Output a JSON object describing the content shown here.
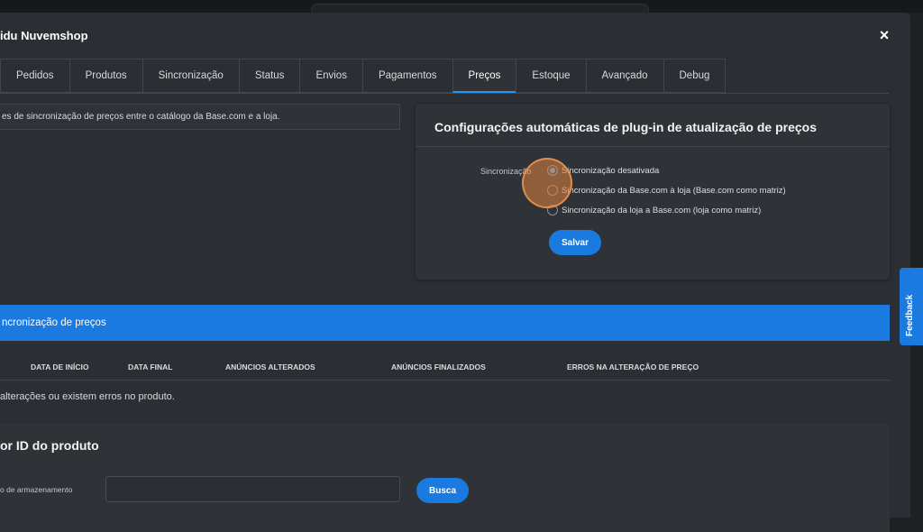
{
  "modal": {
    "title": "idu Nuvemshop",
    "close": "×"
  },
  "tabs": [
    {
      "label": "Pedidos"
    },
    {
      "label": "Produtos"
    },
    {
      "label": "Sincronização"
    },
    {
      "label": "Status"
    },
    {
      "label": "Envios"
    },
    {
      "label": "Pagamentos"
    },
    {
      "label": "Preços",
      "active": true
    },
    {
      "label": "Estoque"
    },
    {
      "label": "Avançado"
    },
    {
      "label": "Debug"
    }
  ],
  "description": "es de sincronização de preços entre o catálogo da Base.com e a loja.",
  "config_card": {
    "title": "Configurações automáticas de plug-in de atualização de preços",
    "sync_label": "Sincronização",
    "options": [
      {
        "label": "Sincronização desativada",
        "checked": true
      },
      {
        "label": "Sincronização da Base.com à loja (Base.com como matriz)",
        "checked": false
      },
      {
        "label": "Sincronização da loja a Base.com (loja como matriz)",
        "checked": false
      }
    ],
    "save_label": "Salvar"
  },
  "history": {
    "banner": "ncronização de preços",
    "columns": [
      "DATA DE INÍCIO",
      "DATA FINAL",
      "ANÚNCIOS ALTERADOS",
      "ANÚNCIOS FINALIZADOS",
      "ERROS NA ALTERAÇÃO DE PREÇO"
    ],
    "empty_message": "alterações ou existem erros no produto."
  },
  "search_card": {
    "title": "or ID do produto",
    "field_label": "o de armazenamento",
    "field_value": "",
    "button_label": "Busca"
  },
  "feedback": {
    "label": "Feedback"
  },
  "colors": {
    "accent": "#1a7ae0",
    "panel": "#2f3237",
    "background": "#2b2e33"
  }
}
